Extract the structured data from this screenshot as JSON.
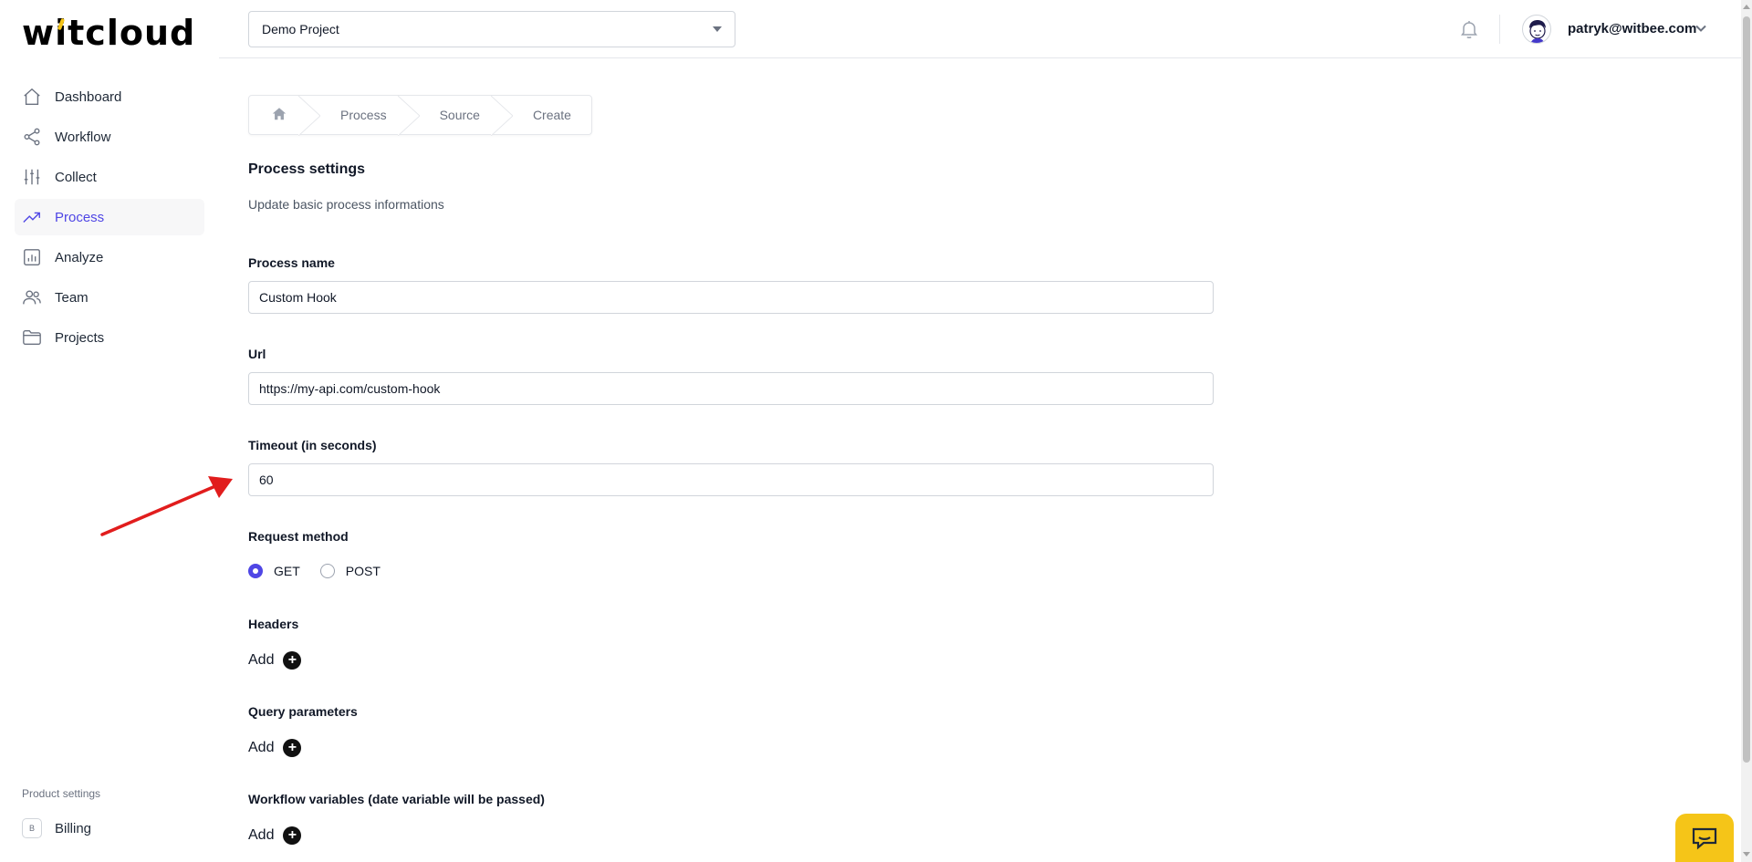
{
  "brand": {
    "logo_text": "witcloud",
    "accent_color": "#f5c518"
  },
  "sidebar": {
    "items": [
      {
        "label": "Dashboard",
        "icon": "home-icon"
      },
      {
        "label": "Workflow",
        "icon": "share-icon"
      },
      {
        "label": "Collect",
        "icon": "sliders-icon"
      },
      {
        "label": "Process",
        "icon": "trending-up-icon",
        "active": true
      },
      {
        "label": "Analyze",
        "icon": "bar-chart-icon"
      },
      {
        "label": "Team",
        "icon": "users-icon"
      },
      {
        "label": "Projects",
        "icon": "folder-icon"
      }
    ],
    "footer_heading": "Product settings",
    "billing": {
      "badge": "B",
      "label": "Billing"
    }
  },
  "header": {
    "project_select": "Demo Project",
    "user_email": "patryk@witbee.com"
  },
  "breadcrumb": {
    "items": [
      "Process",
      "Source",
      "Create"
    ]
  },
  "form": {
    "title": "Process settings",
    "subtitle": "Update basic process informations",
    "process_name": {
      "label": "Process name",
      "value": "Custom Hook"
    },
    "url": {
      "label": "Url",
      "value": "https://my-api.com/custom-hook"
    },
    "timeout": {
      "label": "Timeout (in seconds)",
      "value": "60"
    },
    "request_method": {
      "label": "Request method",
      "options": [
        "GET",
        "POST"
      ],
      "selected": "GET"
    },
    "headers": {
      "label": "Headers",
      "add_label": "Add"
    },
    "query_parameters": {
      "label": "Query parameters",
      "add_label": "Add"
    },
    "workflow_variables": {
      "label": "Workflow variables (date variable will be passed)",
      "add_label": "Add"
    }
  },
  "colors": {
    "primary": "#4f46e5",
    "annotation_arrow": "#e11d1d",
    "chat_widget": "#f5c518"
  }
}
